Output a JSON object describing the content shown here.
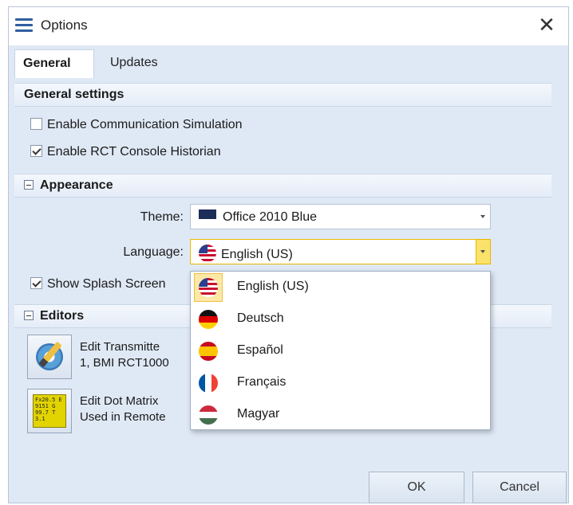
{
  "window": {
    "title": "Options",
    "close_glyph": "✕"
  },
  "tabs": [
    {
      "label": "General",
      "active": true
    },
    {
      "label": "Updates",
      "active": false
    }
  ],
  "general_settings": {
    "header": "General settings",
    "options": [
      {
        "label": "Enable Communication Simulation",
        "checked": false
      },
      {
        "label": "Enable RCT Console Historian",
        "checked": true
      }
    ]
  },
  "appearance": {
    "header": "Appearance",
    "theme_label": "Theme:",
    "theme_value": "Office 2010 Blue",
    "language_label": "Language:",
    "language_value": "English (US)",
    "splash_label": "Show Splash Screen",
    "splash_checked": true
  },
  "editors": {
    "header": "Editors",
    "items": [
      {
        "line1": "Edit Transmitte",
        "line2": "1, BMI RCT1000",
        "icon": "gear-pencil-icon"
      },
      {
        "line1": "Edit Dot Matrix",
        "line2": "Used in Remote",
        "icon": "dot-matrix-icon",
        "icon_text": "Fx20.5 E 9151 G 99.7 T 3.1"
      }
    ]
  },
  "language_dropdown": {
    "options": [
      {
        "label": "English (US)",
        "flag": "us-flag-icon",
        "selected": true
      },
      {
        "label": "Deutsch",
        "flag": "de-flag-icon",
        "selected": false
      },
      {
        "label": "Español",
        "flag": "es-flag-icon",
        "selected": false
      },
      {
        "label": "Français",
        "flag": "fr-flag-icon",
        "selected": false
      },
      {
        "label": "Magyar",
        "flag": "hu-flag-icon",
        "selected": false
      }
    ]
  },
  "buttons": {
    "ok": "OK",
    "cancel": "Cancel"
  },
  "colors": {
    "accent": "#2e5e9e",
    "panel_bg": "#dfe9f5",
    "focus": "#e8b800"
  }
}
